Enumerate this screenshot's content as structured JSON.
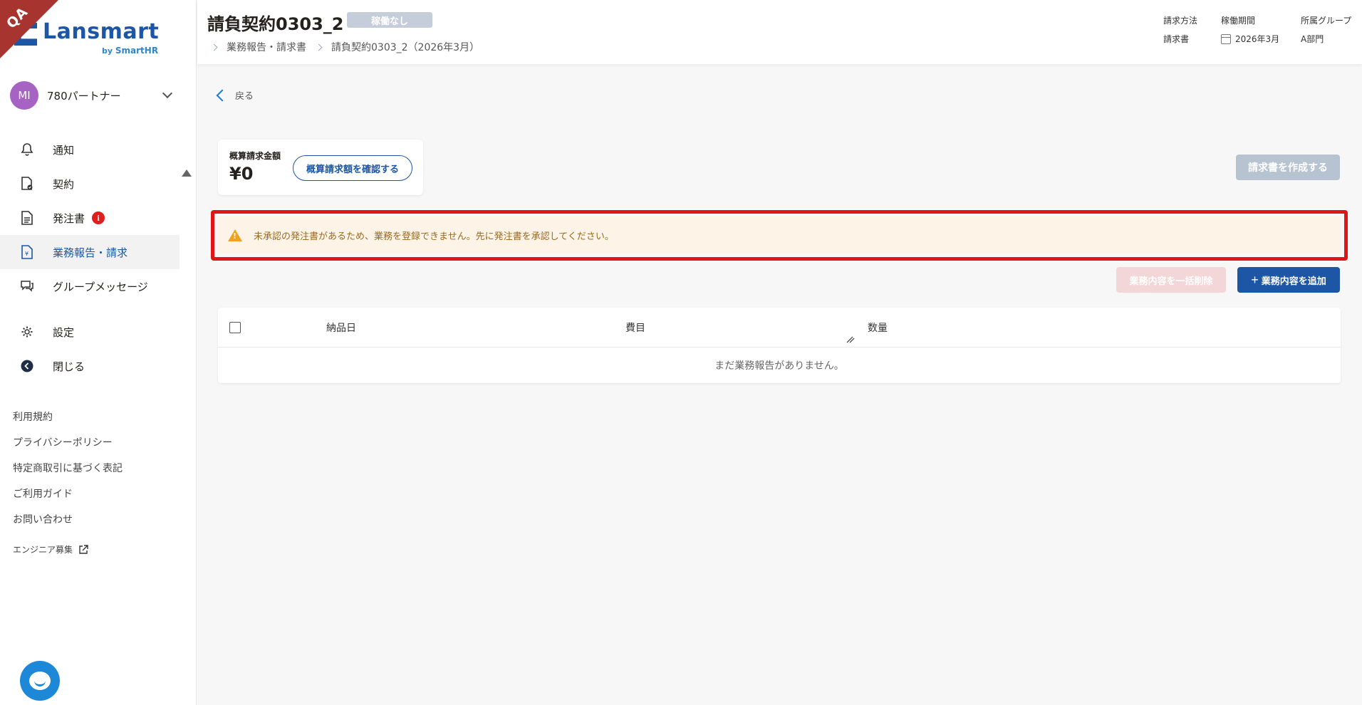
{
  "env_ribbon": "QA",
  "brand": {
    "name": "Lansmart",
    "by": "by",
    "sub": "SmartHR"
  },
  "account": {
    "initials": "MI",
    "name": "780パートナー"
  },
  "nav": [
    {
      "label": "通知",
      "icon": "bell-icon"
    },
    {
      "label": "契約",
      "icon": "contract-icon"
    },
    {
      "label": "発注書",
      "icon": "document-icon",
      "badge": "i"
    },
    {
      "label": "業務報告・請求",
      "icon": "invoice-icon",
      "active": true
    },
    {
      "label": "グループメッセージ",
      "icon": "chat-icon"
    },
    {
      "label": "設定",
      "icon": "gear-icon"
    },
    {
      "label": "閉じる",
      "icon": "collapse-icon"
    }
  ],
  "footer_links": [
    "利用規約",
    "プライバシーポリシー",
    "特定商取引に基づく表記",
    "ご利用ガイド",
    "お問い合わせ",
    "エンジニア募集"
  ],
  "header": {
    "title": "請負契約0303_2",
    "status": "稼働なし",
    "breadcrumb": [
      "業務報告・請求書",
      "請負契約0303_2（2026年3月）"
    ],
    "meta": [
      {
        "label": "請求方法",
        "value": "請求書"
      },
      {
        "label": "稼働期間",
        "value": "2026年3月"
      },
      {
        "label": "所属グループ",
        "value": "A部門"
      }
    ]
  },
  "main": {
    "back_label": "戻る",
    "amount_label": "概算請求金額",
    "amount_value": "¥0",
    "confirm_label": "概算請求額を確認する",
    "create_invoice_label": "請求書を作成する",
    "alert_text": "未承認の発注書があるため、業務を登録できません。先に発注書を承認してください。",
    "bulk_delete_label": "業務内容を一括削除",
    "add_label": "業務内容を追加",
    "table": {
      "columns": [
        "納品日",
        "費目",
        "数量"
      ],
      "empty_text": "まだ業務報告がありません。"
    }
  },
  "colors": {
    "brand": "#1c56a5",
    "alert_border": "#e01616",
    "alert_bg": "#fdf3e6",
    "warning": "#f0a21c",
    "badge": "#e01e1e"
  }
}
